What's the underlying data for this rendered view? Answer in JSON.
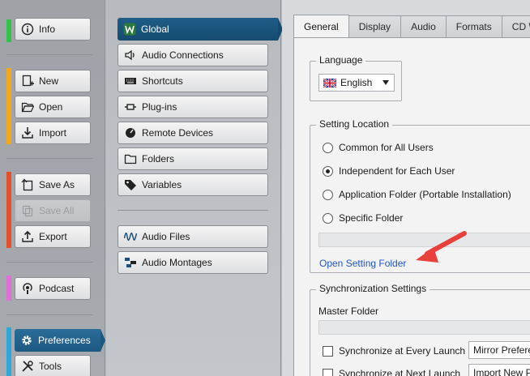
{
  "left_nav": {
    "info": "Info",
    "new": "New",
    "open": "Open",
    "import": "Import",
    "save_as": "Save As",
    "save_all": "Save All",
    "export": "Export",
    "podcast": "Podcast",
    "preferences": "Preferences",
    "tools": "Tools"
  },
  "categories": {
    "global": "Global",
    "audio_connections": "Audio Connections",
    "shortcuts": "Shortcuts",
    "plugins": "Plug-ins",
    "remote_devices": "Remote Devices",
    "folders": "Folders",
    "variables": "Variables",
    "audio_files": "Audio Files",
    "audio_montages": "Audio Montages"
  },
  "tabs": [
    "General",
    "Display",
    "Audio",
    "Formats",
    "CD W"
  ],
  "language": {
    "title": "Language",
    "selected": "English"
  },
  "setting_location": {
    "title": "Setting Location",
    "options": [
      "Common for All Users",
      "Independent for Each User",
      "Application Folder (Portable Installation)",
      "Specific Folder"
    ],
    "selected_index": 1,
    "link": "Open Setting Folder"
  },
  "sync": {
    "title": "Synchronization Settings",
    "master_folder_label": "Master Folder",
    "rows": [
      {
        "label": "Synchronize at Every Launch",
        "dropdown": "Mirror Prefere"
      },
      {
        "label": "Synchronize at Next Launch",
        "dropdown": "Import New P"
      }
    ]
  },
  "colors": {
    "info_bar": "#33c24a",
    "file_bar": "#f2a81d",
    "save_bar": "#e4502a",
    "podcast_bar": "#e070d8",
    "pref_bar": "#2ea8d8",
    "selected": "#1b5a86",
    "link": "#2255cc",
    "arrow": "#e8403a"
  }
}
